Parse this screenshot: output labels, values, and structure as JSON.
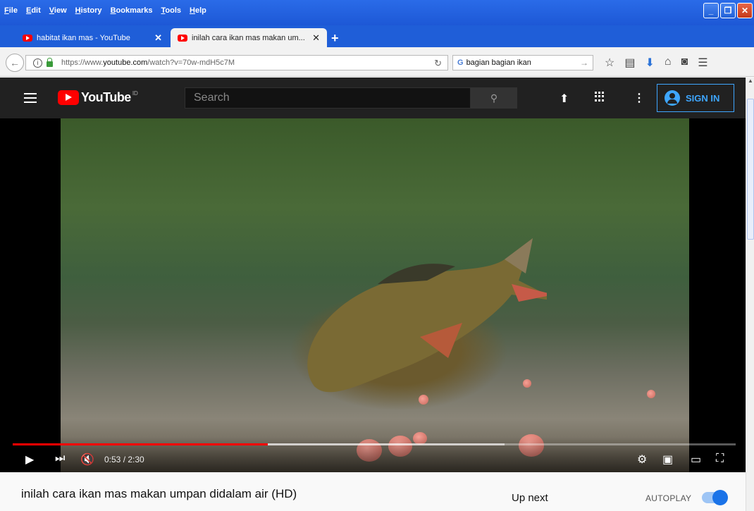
{
  "browser": {
    "menu": [
      "File",
      "Edit",
      "View",
      "History",
      "Bookmarks",
      "Tools",
      "Help"
    ],
    "tabs": [
      {
        "label": "habitat ikan mas - YouTube",
        "active": false
      },
      {
        "label": "inilah cara ikan mas makan um...",
        "active": true
      }
    ],
    "new_tab": "+",
    "url_prefix": "https://www.",
    "url_domain": "youtube.com",
    "url_path": "/watch?v=70w-mdH5c7M",
    "search_value": "bagian bagian ikan"
  },
  "youtube": {
    "logo_text": "YouTube",
    "country": "ID",
    "search_placeholder": "Search",
    "sign_in": "SIGN IN"
  },
  "player": {
    "current_time": "0:53",
    "duration": "2:30",
    "time_display": "0:53 / 2:30",
    "progress_fraction": 0.353,
    "buffered_fraction": 0.68
  },
  "video": {
    "title": "inilah cara ikan mas makan umpan didalam air (HD)"
  },
  "sidebar": {
    "up_next": "Up next",
    "autoplay": "AUTOPLAY",
    "autoplay_on": true
  },
  "colors": {
    "youtube_red": "#ff0000",
    "header_dark": "#212121",
    "signin_blue": "#3ea6ff",
    "toggle_blue": "#1a73e8"
  }
}
